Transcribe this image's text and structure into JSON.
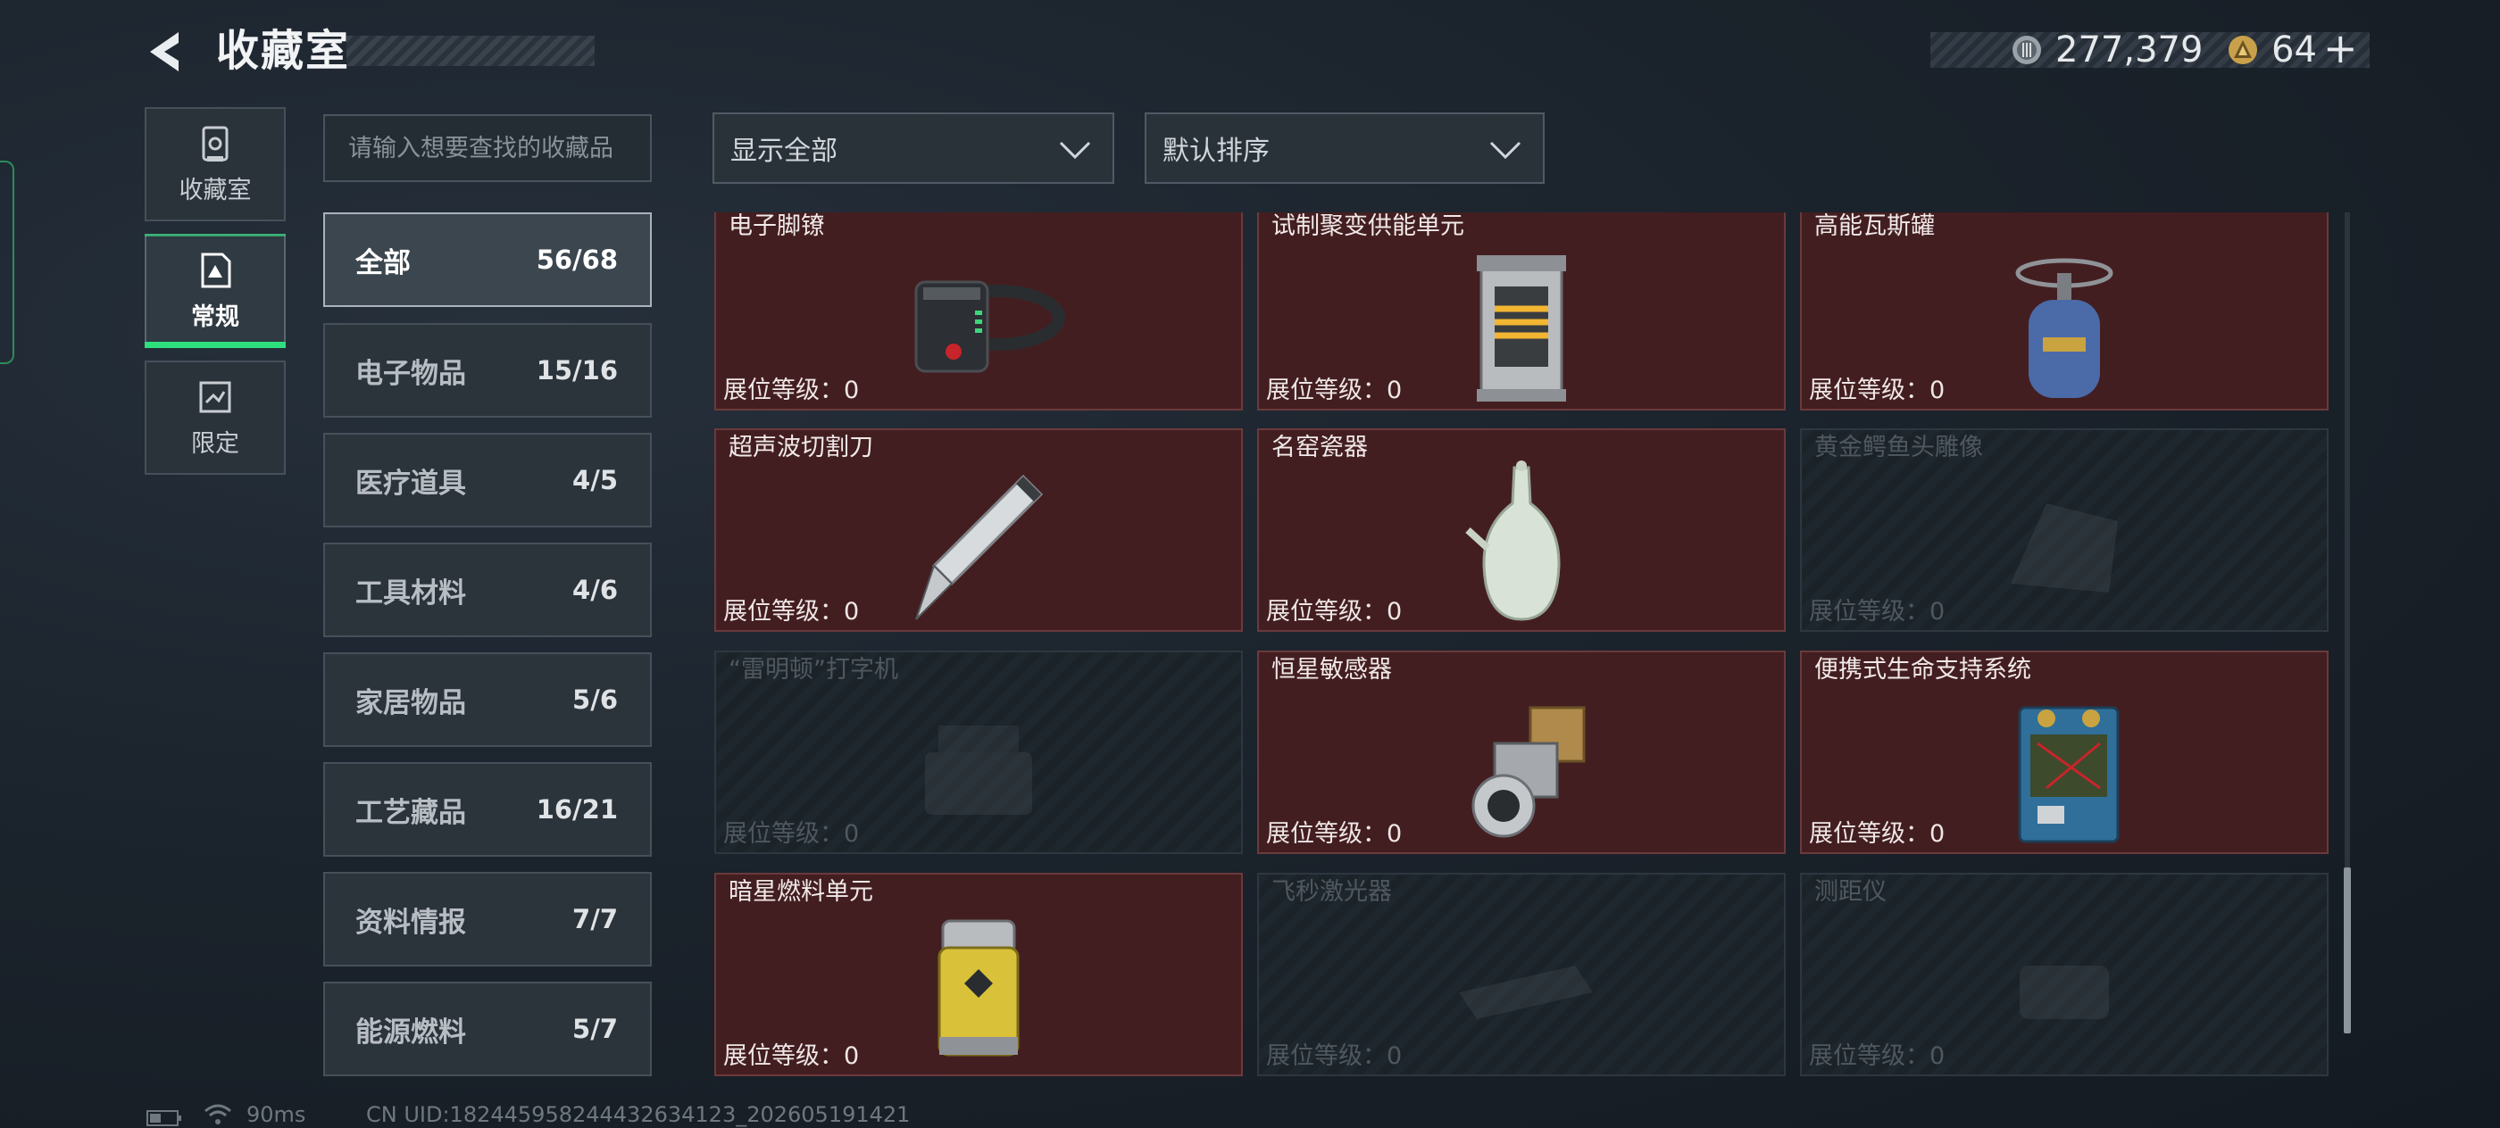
{
  "header": {
    "title": "收藏室",
    "currency_value": "277,379",
    "token_value": "64",
    "token_plus": "+"
  },
  "side_tabs": [
    {
      "label": "收藏室",
      "icon": "vault-icon",
      "active": false
    },
    {
      "label": "常规",
      "icon": "document-icon",
      "active": true
    },
    {
      "label": "限定",
      "icon": "limited-icon",
      "active": false
    }
  ],
  "search": {
    "placeholder": "请输入想要查找的收藏品",
    "value": ""
  },
  "filters": {
    "display": "显示全部",
    "sort": "默认排序"
  },
  "categories": [
    {
      "name": "全部",
      "count": "56/68",
      "active": true
    },
    {
      "name": "电子物品",
      "count": "15/16"
    },
    {
      "name": "医疗道具",
      "count": "4/5"
    },
    {
      "name": "工具材料",
      "count": "4/6"
    },
    {
      "name": "家居物品",
      "count": "5/6"
    },
    {
      "name": "工艺藏品",
      "count": "16/21"
    },
    {
      "name": "资料情报",
      "count": "7/7"
    },
    {
      "name": "能源燃料",
      "count": "5/7"
    }
  ],
  "items": [
    {
      "name": "电子脚镣",
      "level": "展位等级：0",
      "owned": true,
      "icon": "ankle-monitor-icon"
    },
    {
      "name": "试制聚变供能单元",
      "level": "展位等级：0",
      "owned": true,
      "icon": "fusion-cell-icon"
    },
    {
      "name": "高能瓦斯罐",
      "level": "展位等级：0",
      "owned": true,
      "icon": "gas-tank-icon"
    },
    {
      "name": "超声波切割刀",
      "level": "展位等级：0",
      "owned": true,
      "icon": "ultrasonic-cutter-icon"
    },
    {
      "name": "名窑瓷器",
      "level": "展位等级：0",
      "owned": true,
      "icon": "porcelain-vase-icon"
    },
    {
      "name": "黄金鳄鱼头雕像",
      "level": "展位等级：0",
      "owned": false,
      "icon": "statue-icon"
    },
    {
      "name": "“雷明顿”打字机",
      "level": "展位等级：0",
      "owned": false,
      "icon": "typewriter-icon"
    },
    {
      "name": "恒星敏感器",
      "level": "展位等级：0",
      "owned": true,
      "icon": "star-sensor-icon"
    },
    {
      "name": "便携式生命支持系统",
      "level": "展位等级：0",
      "owned": true,
      "icon": "life-support-icon"
    },
    {
      "name": "暗星燃料单元",
      "level": "展位等级：0",
      "owned": true,
      "icon": "fuel-canister-icon"
    },
    {
      "name": "飞秒激光器",
      "level": "展位等级：0",
      "owned": false,
      "icon": "laser-icon"
    },
    {
      "name": "测距仪",
      "level": "展位等级：0",
      "owned": false,
      "icon": "rangefinder-icon"
    }
  ],
  "footer": {
    "ping": "90ms",
    "uid": "CN UID:182445958244432634123_202605191421"
  },
  "colors": {
    "accent_green": "#2ee07d",
    "owned_card": "#431e20",
    "background": "#1b232c"
  }
}
